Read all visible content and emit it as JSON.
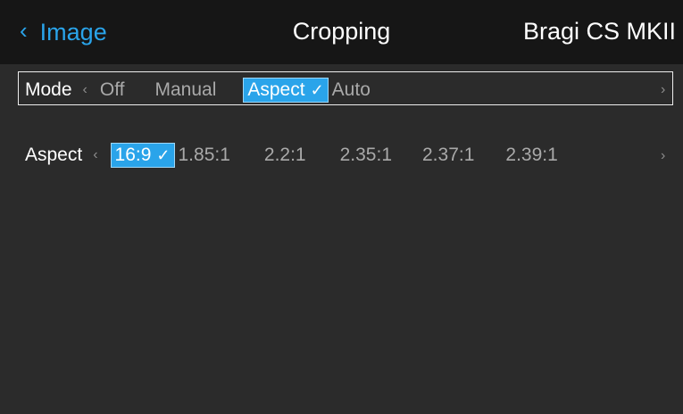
{
  "header": {
    "back_label": "Image",
    "title": "Cropping",
    "device": "Bragi CS MKII"
  },
  "mode_row": {
    "label": "Mode",
    "left_arrow": "‹",
    "right_arrow": "›",
    "options": [
      "Off",
      "Manual",
      "Aspect",
      "Auto"
    ],
    "selected": "Aspect",
    "check": "✓"
  },
  "aspect_row": {
    "label": "Aspect",
    "left_arrow": "‹",
    "right_arrow": "›",
    "options": [
      "16:9",
      "1.85:1",
      "2.2:1",
      "2.35:1",
      "2.37:1",
      "2.39:1"
    ],
    "selected": "16:9",
    "check": "✓"
  },
  "colors": {
    "accent": "#2aa4ea",
    "header_bg": "#161616",
    "body_bg": "#2b2b2b",
    "inactive_text": "#a9a9a9"
  },
  "icons": {
    "back": "chevron-left-icon",
    "prev": "chevron-left-icon",
    "next": "chevron-right-icon",
    "check": "checkmark-icon"
  }
}
